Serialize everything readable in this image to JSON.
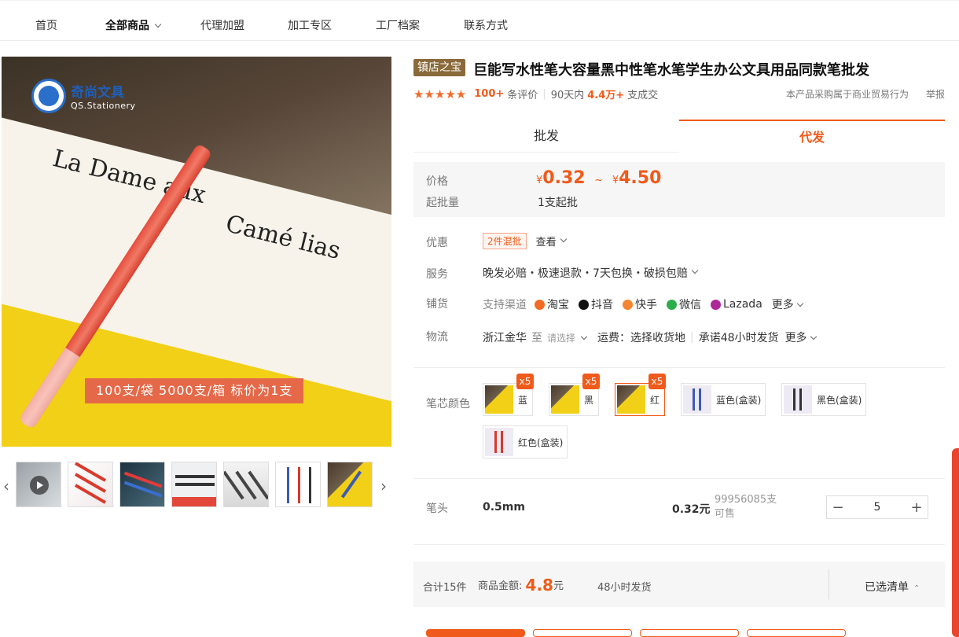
{
  "nav": {
    "items": [
      {
        "label": "首页"
      },
      {
        "label": "全部商品"
      },
      {
        "label": "代理加盟"
      },
      {
        "label": "加工专区"
      },
      {
        "label": "工厂档案"
      },
      {
        "label": "联系方式"
      }
    ]
  },
  "gallery": {
    "logo_cn": "奇尚文具",
    "logo_en": "QS.Stationery",
    "banner": "100支/袋  5000支/箱  标价为1支",
    "photo_text": [
      "La Dame aux",
      "Camé lias"
    ],
    "thumbnail_count": 7
  },
  "product": {
    "badge": "镇店之宝",
    "title": "巨能写水性笔大容量黑中性笔水笔学生办公文具用品同款笔批发",
    "stars": "★★★★★",
    "review_count": "100+",
    "review_label": "条评价",
    "sales_prefix": "90天内",
    "sales_count": "4.4万+",
    "sales_suffix": "支成交",
    "notice": "本产品采购属于商业贸易行为",
    "report": "举报"
  },
  "tabs": {
    "wholesale": "批发",
    "dropship": "代发"
  },
  "price": {
    "label": "价格",
    "currency": "¥",
    "low": "0.32",
    "tilde": "~",
    "high": "4.50",
    "moq_label": "起批量",
    "moq_value": "1支起批"
  },
  "rows": {
    "promo_label": "优惠",
    "promo_tag": "2件混批",
    "promo_view": "查看",
    "service_label": "服务",
    "service_value": "晚发必赔・极速退款・7天包换・破损包赔",
    "channel_label": "铺货",
    "channel_prefix": "支持渠道",
    "channels": [
      {
        "name": "淘宝",
        "color": "#f36b23"
      },
      {
        "name": "抖音",
        "color": "#111111"
      },
      {
        "name": "快手",
        "color": "#f5852e"
      },
      {
        "name": "微信",
        "color": "#2aae4b"
      },
      {
        "name": "Lazada",
        "color": "#b0279a"
      }
    ],
    "channel_more": "更多",
    "logistics_label": "物流",
    "logistics_origin": "浙江金华",
    "logistics_to": "至",
    "logistics_select": "请选择",
    "logistics_fee": "运费：选择收货地",
    "logistics_promise": "承诺48小时发货",
    "logistics_more": "更多"
  },
  "sku": {
    "label": "笔芯颜色",
    "options": [
      {
        "name": "蓝",
        "badge": "x5",
        "selected": false
      },
      {
        "name": "黑",
        "badge": "x5",
        "selected": false
      },
      {
        "name": "红",
        "badge": "x5",
        "selected": true
      },
      {
        "name": "蓝色(盒装)",
        "badge": "",
        "selected": false
      },
      {
        "name": "黑色(盒装)",
        "badge": "",
        "selected": false
      },
      {
        "name": "红色(盒装)",
        "badge": "",
        "selected": false
      }
    ]
  },
  "tip": {
    "label": "笔头",
    "value": "0.5mm",
    "price": "0.32元",
    "stock": "99956085支",
    "stock_label": "可售",
    "qty": "5",
    "minus": "−",
    "plus": "+"
  },
  "summary": {
    "count": "合计15件",
    "amount_label": "商品金额:",
    "amount": "4.8",
    "amount_unit": "元",
    "ship": "48小时发货",
    "selected_list": "已选清单"
  },
  "colors": {
    "accent": "#f05a1a",
    "badge_bg": "#8a6a3a"
  }
}
